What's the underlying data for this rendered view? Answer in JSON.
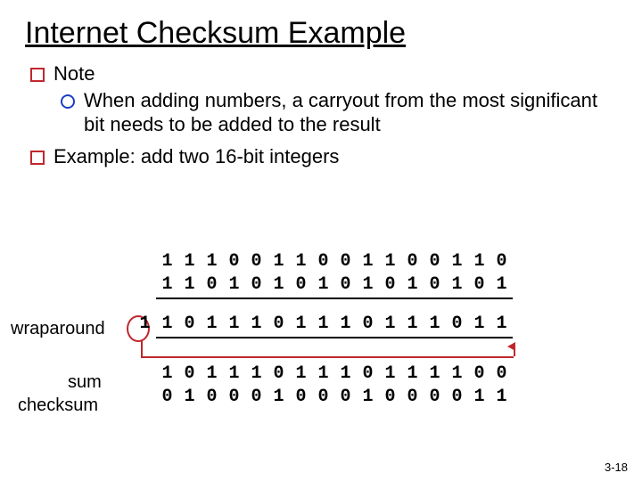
{
  "title": "Internet Checksum Example",
  "bullets": {
    "note_label": "Note",
    "note_sub": "When adding numbers, a carryout from the most significant bit needs to be added to the result",
    "example_label": "Example: add two 16-bit integers"
  },
  "labels": {
    "wraparound": "wraparound",
    "sum": "sum",
    "checksum": "checksum"
  },
  "footer": "3-18",
  "chart_data": {
    "type": "table",
    "title": "16-bit one's complement addition example",
    "rows": [
      {
        "name": "operand_a",
        "carry": "",
        "bits": [
          "1",
          "1",
          "1",
          "0",
          "0",
          "1",
          "1",
          "0",
          "0",
          "1",
          "1",
          "0",
          "0",
          "1",
          "1",
          "0"
        ]
      },
      {
        "name": "operand_b",
        "carry": "",
        "bits": [
          "1",
          "1",
          "0",
          "1",
          "0",
          "1",
          "0",
          "1",
          "0",
          "1",
          "0",
          "1",
          "0",
          "1",
          "0",
          "1"
        ]
      },
      {
        "name": "raw_sum",
        "carry": "1",
        "bits": [
          "1",
          "0",
          "1",
          "1",
          "1",
          "0",
          "1",
          "1",
          "1",
          "0",
          "1",
          "1",
          "1",
          "0",
          "1",
          "1"
        ]
      },
      {
        "name": "sum",
        "carry": "",
        "bits": [
          "1",
          "0",
          "1",
          "1",
          "1",
          "0",
          "1",
          "1",
          "1",
          "0",
          "1",
          "1",
          "1",
          "1",
          "0",
          "0"
        ]
      },
      {
        "name": "checksum",
        "carry": "",
        "bits": [
          "0",
          "1",
          "0",
          "0",
          "0",
          "1",
          "0",
          "0",
          "0",
          "1",
          "0",
          "0",
          "0",
          "0",
          "1",
          "1"
        ]
      }
    ]
  }
}
